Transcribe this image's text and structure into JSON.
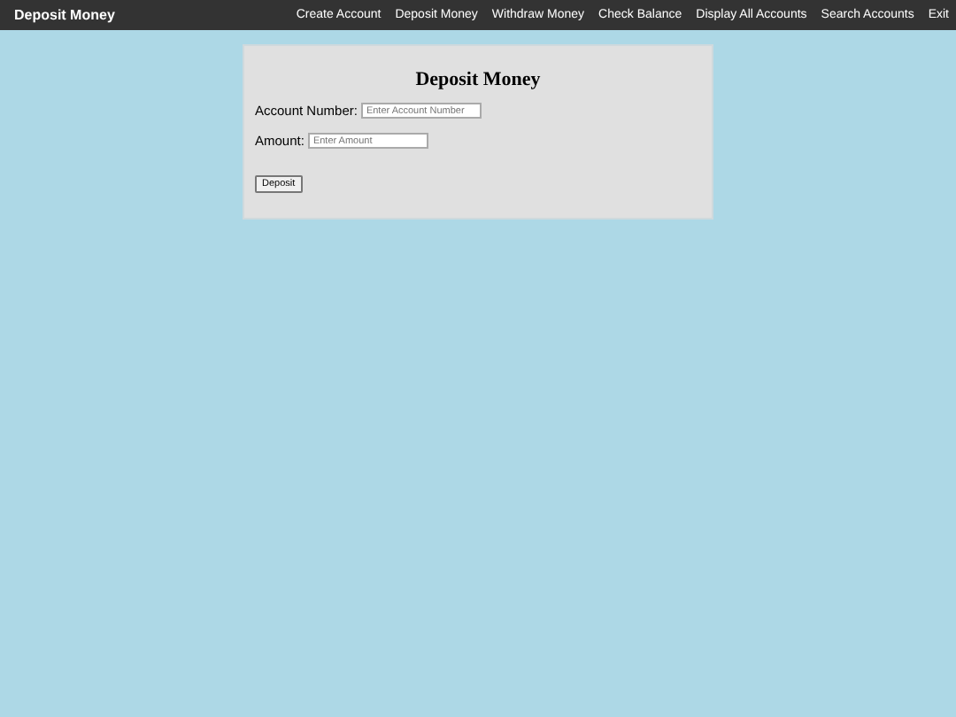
{
  "navbar": {
    "brand": "Deposit Money",
    "links": [
      {
        "label": "Create Account"
      },
      {
        "label": "Deposit Money"
      },
      {
        "label": "Withdraw Money"
      },
      {
        "label": "Check Balance"
      },
      {
        "label": "Display All Accounts"
      },
      {
        "label": "Search Accounts"
      },
      {
        "label": "Exit"
      }
    ]
  },
  "form": {
    "title": "Deposit Money",
    "fields": [
      {
        "label": "Account Number:",
        "placeholder": "Enter Account Number"
      },
      {
        "label": "Amount:",
        "placeholder": "Enter Amount"
      }
    ],
    "button": "Deposit"
  }
}
